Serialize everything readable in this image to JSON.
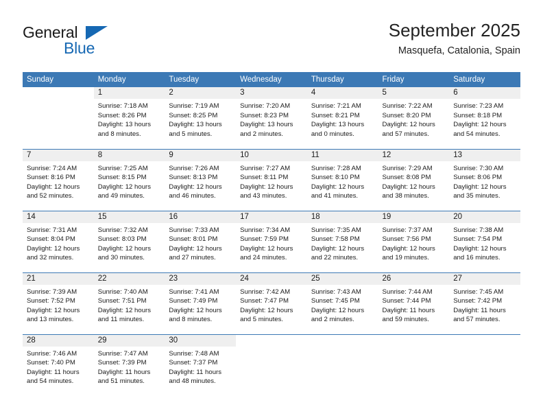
{
  "brand": {
    "name_part1": "General",
    "name_part2": "Blue",
    "colors": {
      "accent": "#1668b3",
      "header": "#3c79b5",
      "daynum_bg": "#efefef"
    }
  },
  "header": {
    "title": "September 2025",
    "subtitle": "Masquefa, Catalonia, Spain"
  },
  "weekday_headers": [
    "Sunday",
    "Monday",
    "Tuesday",
    "Wednesday",
    "Thursday",
    "Friday",
    "Saturday"
  ],
  "weeks": [
    [
      {
        "day": "",
        "lines": []
      },
      {
        "day": "1",
        "lines": [
          "Sunrise: 7:18 AM",
          "Sunset: 8:26 PM",
          "Daylight: 13 hours",
          "and 8 minutes."
        ]
      },
      {
        "day": "2",
        "lines": [
          "Sunrise: 7:19 AM",
          "Sunset: 8:25 PM",
          "Daylight: 13 hours",
          "and 5 minutes."
        ]
      },
      {
        "day": "3",
        "lines": [
          "Sunrise: 7:20 AM",
          "Sunset: 8:23 PM",
          "Daylight: 13 hours",
          "and 2 minutes."
        ]
      },
      {
        "day": "4",
        "lines": [
          "Sunrise: 7:21 AM",
          "Sunset: 8:21 PM",
          "Daylight: 13 hours",
          "and 0 minutes."
        ]
      },
      {
        "day": "5",
        "lines": [
          "Sunrise: 7:22 AM",
          "Sunset: 8:20 PM",
          "Daylight: 12 hours",
          "and 57 minutes."
        ]
      },
      {
        "day": "6",
        "lines": [
          "Sunrise: 7:23 AM",
          "Sunset: 8:18 PM",
          "Daylight: 12 hours",
          "and 54 minutes."
        ]
      }
    ],
    [
      {
        "day": "7",
        "lines": [
          "Sunrise: 7:24 AM",
          "Sunset: 8:16 PM",
          "Daylight: 12 hours",
          "and 52 minutes."
        ]
      },
      {
        "day": "8",
        "lines": [
          "Sunrise: 7:25 AM",
          "Sunset: 8:15 PM",
          "Daylight: 12 hours",
          "and 49 minutes."
        ]
      },
      {
        "day": "9",
        "lines": [
          "Sunrise: 7:26 AM",
          "Sunset: 8:13 PM",
          "Daylight: 12 hours",
          "and 46 minutes."
        ]
      },
      {
        "day": "10",
        "lines": [
          "Sunrise: 7:27 AM",
          "Sunset: 8:11 PM",
          "Daylight: 12 hours",
          "and 43 minutes."
        ]
      },
      {
        "day": "11",
        "lines": [
          "Sunrise: 7:28 AM",
          "Sunset: 8:10 PM",
          "Daylight: 12 hours",
          "and 41 minutes."
        ]
      },
      {
        "day": "12",
        "lines": [
          "Sunrise: 7:29 AM",
          "Sunset: 8:08 PM",
          "Daylight: 12 hours",
          "and 38 minutes."
        ]
      },
      {
        "day": "13",
        "lines": [
          "Sunrise: 7:30 AM",
          "Sunset: 8:06 PM",
          "Daylight: 12 hours",
          "and 35 minutes."
        ]
      }
    ],
    [
      {
        "day": "14",
        "lines": [
          "Sunrise: 7:31 AM",
          "Sunset: 8:04 PM",
          "Daylight: 12 hours",
          "and 32 minutes."
        ]
      },
      {
        "day": "15",
        "lines": [
          "Sunrise: 7:32 AM",
          "Sunset: 8:03 PM",
          "Daylight: 12 hours",
          "and 30 minutes."
        ]
      },
      {
        "day": "16",
        "lines": [
          "Sunrise: 7:33 AM",
          "Sunset: 8:01 PM",
          "Daylight: 12 hours",
          "and 27 minutes."
        ]
      },
      {
        "day": "17",
        "lines": [
          "Sunrise: 7:34 AM",
          "Sunset: 7:59 PM",
          "Daylight: 12 hours",
          "and 24 minutes."
        ]
      },
      {
        "day": "18",
        "lines": [
          "Sunrise: 7:35 AM",
          "Sunset: 7:58 PM",
          "Daylight: 12 hours",
          "and 22 minutes."
        ]
      },
      {
        "day": "19",
        "lines": [
          "Sunrise: 7:37 AM",
          "Sunset: 7:56 PM",
          "Daylight: 12 hours",
          "and 19 minutes."
        ]
      },
      {
        "day": "20",
        "lines": [
          "Sunrise: 7:38 AM",
          "Sunset: 7:54 PM",
          "Daylight: 12 hours",
          "and 16 minutes."
        ]
      }
    ],
    [
      {
        "day": "21",
        "lines": [
          "Sunrise: 7:39 AM",
          "Sunset: 7:52 PM",
          "Daylight: 12 hours",
          "and 13 minutes."
        ]
      },
      {
        "day": "22",
        "lines": [
          "Sunrise: 7:40 AM",
          "Sunset: 7:51 PM",
          "Daylight: 12 hours",
          "and 11 minutes."
        ]
      },
      {
        "day": "23",
        "lines": [
          "Sunrise: 7:41 AM",
          "Sunset: 7:49 PM",
          "Daylight: 12 hours",
          "and 8 minutes."
        ]
      },
      {
        "day": "24",
        "lines": [
          "Sunrise: 7:42 AM",
          "Sunset: 7:47 PM",
          "Daylight: 12 hours",
          "and 5 minutes."
        ]
      },
      {
        "day": "25",
        "lines": [
          "Sunrise: 7:43 AM",
          "Sunset: 7:45 PM",
          "Daylight: 12 hours",
          "and 2 minutes."
        ]
      },
      {
        "day": "26",
        "lines": [
          "Sunrise: 7:44 AM",
          "Sunset: 7:44 PM",
          "Daylight: 11 hours",
          "and 59 minutes."
        ]
      },
      {
        "day": "27",
        "lines": [
          "Sunrise: 7:45 AM",
          "Sunset: 7:42 PM",
          "Daylight: 11 hours",
          "and 57 minutes."
        ]
      }
    ],
    [
      {
        "day": "28",
        "lines": [
          "Sunrise: 7:46 AM",
          "Sunset: 7:40 PM",
          "Daylight: 11 hours",
          "and 54 minutes."
        ]
      },
      {
        "day": "29",
        "lines": [
          "Sunrise: 7:47 AM",
          "Sunset: 7:39 PM",
          "Daylight: 11 hours",
          "and 51 minutes."
        ]
      },
      {
        "day": "30",
        "lines": [
          "Sunrise: 7:48 AM",
          "Sunset: 7:37 PM",
          "Daylight: 11 hours",
          "and 48 minutes."
        ]
      },
      {
        "day": "",
        "lines": []
      },
      {
        "day": "",
        "lines": []
      },
      {
        "day": "",
        "lines": []
      },
      {
        "day": "",
        "lines": []
      }
    ]
  ]
}
